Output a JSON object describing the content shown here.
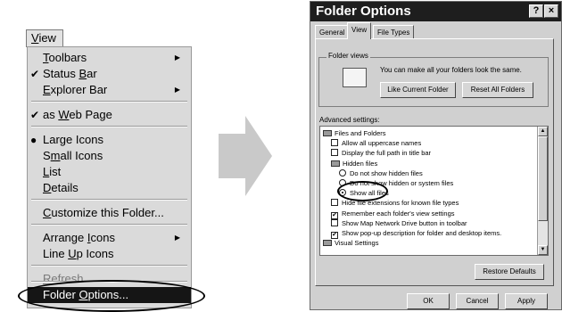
{
  "menu": {
    "title": {
      "u": "V",
      "rest": "iew"
    },
    "items": [
      {
        "label_pre": "",
        "u": "T",
        "label_post": "oolbars",
        "mark": "",
        "submenu": true
      },
      {
        "label_pre": "Status ",
        "u": "B",
        "label_post": "ar",
        "mark": "✔",
        "submenu": false
      },
      {
        "label_pre": "",
        "u": "E",
        "label_post": "xplorer Bar",
        "mark": "",
        "submenu": true
      },
      {
        "label_pre": "as ",
        "u": "W",
        "label_post": "eb Page",
        "mark": "✔",
        "submenu": false
      },
      {
        "label_pre": "Lar",
        "u": "g",
        "label_post": "e Icons",
        "mark": "●",
        "submenu": false
      },
      {
        "label_pre": "S",
        "u": "m",
        "label_post": "all Icons",
        "mark": "",
        "submenu": false
      },
      {
        "label_pre": "",
        "u": "L",
        "label_post": "ist",
        "mark": "",
        "submenu": false
      },
      {
        "label_pre": "",
        "u": "D",
        "label_post": "etails",
        "mark": "",
        "submenu": false
      },
      {
        "label_pre": "",
        "u": "C",
        "label_post": "ustomize this Folder...",
        "mark": "",
        "submenu": false
      },
      {
        "label_pre": "Arrange ",
        "u": "I",
        "label_post": "cons",
        "mark": "",
        "submenu": true
      },
      {
        "label_pre": "Line ",
        "u": "U",
        "label_post": "p Icons",
        "mark": "",
        "submenu": false
      },
      {
        "label_pre": "",
        "u": "R",
        "label_post": "efresh",
        "mark": "",
        "submenu": false
      },
      {
        "label_pre": "Folder ",
        "u": "O",
        "label_post": "ptions...",
        "mark": "",
        "submenu": false
      }
    ]
  },
  "dialog": {
    "title": "Folder Options",
    "help_btn": "?",
    "close_btn": "×",
    "tabs": [
      "General",
      "View",
      "File Types"
    ],
    "folder_views": {
      "label": "Folder views",
      "text": "You can make all your folders look the same.",
      "btn_like": "Like Current Folder",
      "btn_reset": "Reset All Folders"
    },
    "advanced_label": "Advanced settings:",
    "tree": [
      {
        "kind": "folder",
        "indent": 0,
        "label": "Files and Folders"
      },
      {
        "kind": "check",
        "indent": 1,
        "checked": false,
        "label": "Allow all uppercase names"
      },
      {
        "kind": "check",
        "indent": 1,
        "checked": false,
        "label": "Display the full path in title bar"
      },
      {
        "kind": "folder",
        "indent": 1,
        "label": "Hidden files"
      },
      {
        "kind": "radio",
        "indent": 2,
        "on": false,
        "label": "Do not show hidden files"
      },
      {
        "kind": "radio",
        "indent": 2,
        "on": false,
        "label": "Do not show hidden or system files"
      },
      {
        "kind": "radio",
        "indent": 2,
        "on": true,
        "label": "Show all files"
      },
      {
        "kind": "check",
        "indent": 1,
        "checked": false,
        "label": "Hide file extensions for known file types"
      },
      {
        "kind": "check",
        "indent": 1,
        "checked": true,
        "label": "Remember each folder's view settings"
      },
      {
        "kind": "check",
        "indent": 1,
        "checked": false,
        "label": "Show Map Network Drive button in toolbar"
      },
      {
        "kind": "check",
        "indent": 1,
        "checked": true,
        "label": "Show pop-up description for folder and desktop items."
      },
      {
        "kind": "folder",
        "indent": 0,
        "label": "Visual Settings"
      }
    ],
    "btn_restore": "Restore Defaults",
    "btn_ok": "OK",
    "btn_cancel": "Cancel",
    "btn_apply": "Apply"
  }
}
